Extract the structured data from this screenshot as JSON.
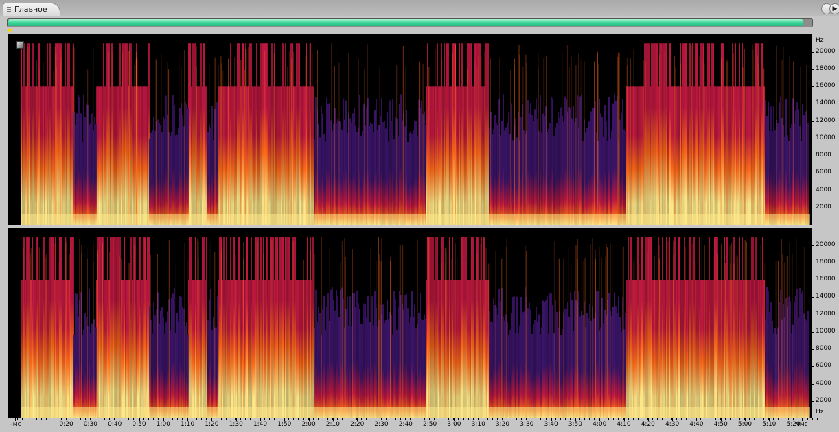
{
  "tab": {
    "label": "Главное"
  },
  "titlebar": {
    "play_glyph": "▶"
  },
  "progress": {
    "fraction": 0.99
  },
  "hz_axis": {
    "unit": "Hz",
    "ticks": [
      "20000",
      "18000",
      "16000",
      "14000",
      "12000",
      "10000",
      "8000",
      "6000",
      "4000",
      "2000"
    ]
  },
  "time_axis": {
    "start_label": "чмс",
    "end_label": "чмс",
    "labels": [
      "0:20",
      "0:30",
      "0:40",
      "0:50",
      "1:00",
      "1:10",
      "1:20",
      "1:30",
      "1:40",
      "1:50",
      "2:00",
      "2:10",
      "2:20",
      "2:30",
      "2:40",
      "2:50",
      "3:00",
      "3:10",
      "3:20",
      "3:30",
      "3:40",
      "3:50",
      "4:00",
      "4:10",
      "4:20",
      "4:30",
      "4:40",
      "4:50",
      "5:00",
      "5:10",
      "5:20"
    ]
  },
  "colors": {
    "progress": "#39d79a",
    "spectrum_high": "#ffe98a",
    "spectrum_mid": "#ff6a1a",
    "spectrum_low": "#c01840",
    "spectrum_faint": "#3a1468",
    "background": "#000000"
  }
}
